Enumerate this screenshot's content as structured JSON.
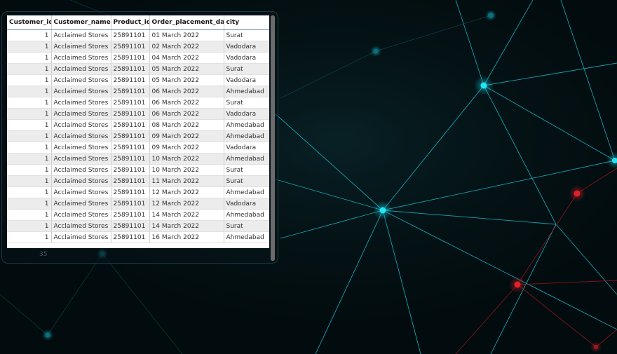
{
  "table": {
    "columns": [
      "Customer_id",
      "Customer_name",
      "Product_id",
      "Order_placement_date",
      "city"
    ],
    "rows": [
      [
        "1",
        "Acclaimed Stores",
        "25891101",
        "01 March 2022",
        "Surat"
      ],
      [
        "1",
        "Acclaimed Stores",
        "25891101",
        "02 March 2022",
        "Vadodara"
      ],
      [
        "1",
        "Acclaimed Stores",
        "25891101",
        "04 March 2022",
        "Vadodara"
      ],
      [
        "1",
        "Acclaimed Stores",
        "25891101",
        "05 March 2022",
        "Surat"
      ],
      [
        "1",
        "Acclaimed Stores",
        "25891101",
        "05 March 2022",
        "Vadodara"
      ],
      [
        "1",
        "Acclaimed Stores",
        "25891101",
        "06 March 2022",
        "Ahmedabad"
      ],
      [
        "1",
        "Acclaimed Stores",
        "25891101",
        "06 March 2022",
        "Surat"
      ],
      [
        "1",
        "Acclaimed Stores",
        "25891101",
        "06 March 2022",
        "Vadodara"
      ],
      [
        "1",
        "Acclaimed Stores",
        "25891101",
        "08 March 2022",
        "Ahmedabad"
      ],
      [
        "1",
        "Acclaimed Stores",
        "25891101",
        "09 March 2022",
        "Ahmedabad"
      ],
      [
        "1",
        "Acclaimed Stores",
        "25891101",
        "09 March 2022",
        "Vadodara"
      ],
      [
        "1",
        "Acclaimed Stores",
        "25891101",
        "10 March 2022",
        "Ahmedabad"
      ],
      [
        "1",
        "Acclaimed Stores",
        "25891101",
        "10 March 2022",
        "Surat"
      ],
      [
        "1",
        "Acclaimed Stores",
        "25891101",
        "11 March 2022",
        "Surat"
      ],
      [
        "1",
        "Acclaimed Stores",
        "25891101",
        "12 March 2022",
        "Ahmedabad"
      ],
      [
        "1",
        "Acclaimed Stores",
        "25891101",
        "12 March 2022",
        "Vadodara"
      ],
      [
        "1",
        "Acclaimed Stores",
        "25891101",
        "14 March 2022",
        "Ahmedabad"
      ],
      [
        "1",
        "Acclaimed Stores",
        "25891101",
        "14 March 2022",
        "Surat"
      ],
      [
        "1",
        "Acclaimed Stores",
        "25891101",
        "16 March 2022",
        "Ahmedabad"
      ]
    ]
  },
  "footer": {
    "page_number": "35"
  },
  "colors": {
    "background": "#020b0d",
    "network_cyan": "#16d6e8",
    "network_red": "#e0202a",
    "row_alt": "#ececec",
    "header_border": "#6a8fb0"
  }
}
